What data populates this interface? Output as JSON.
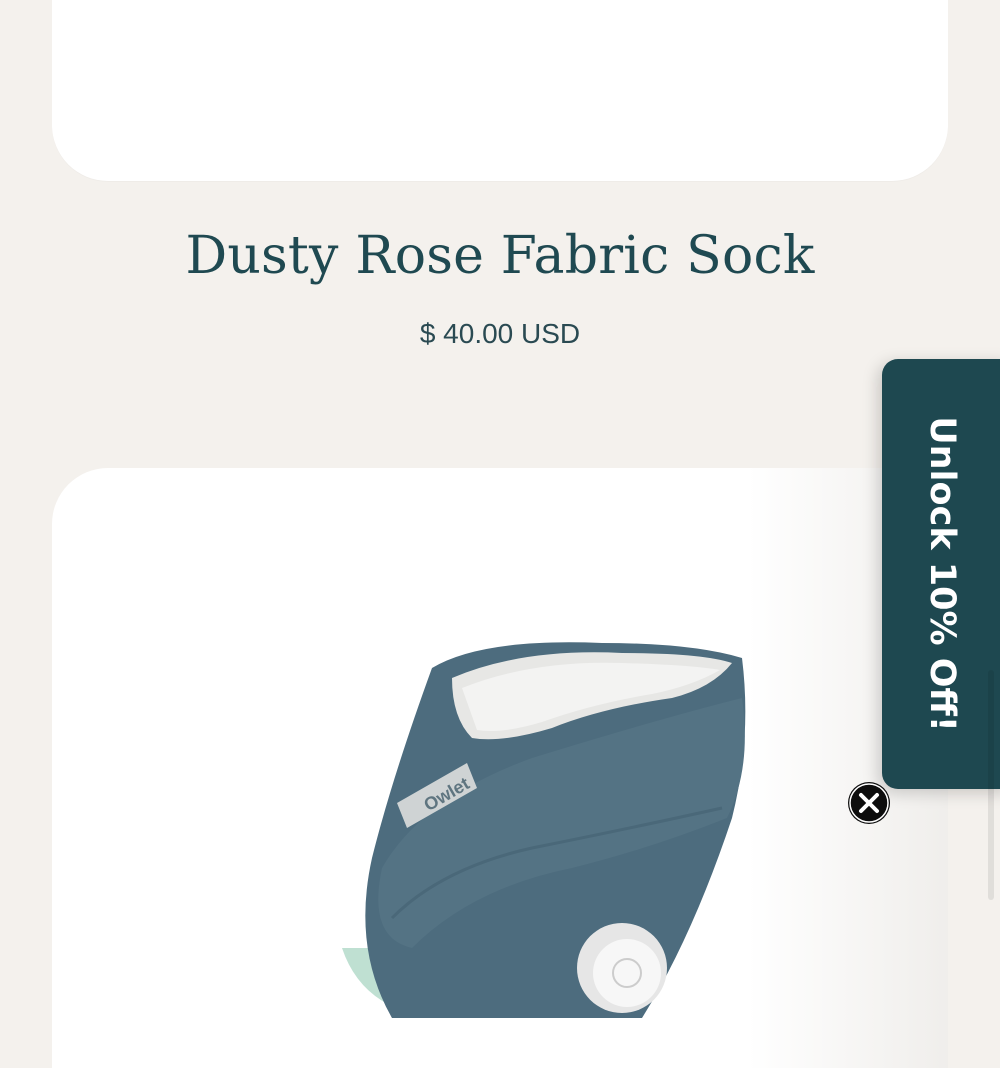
{
  "product": {
    "title": "Dusty Rose Fabric Sock",
    "price": "$ 40.00 USD",
    "image_icon": "baby-sock-icon",
    "image_brand_text": "Owlet"
  },
  "promo": {
    "label": "Unlock 10% Off!",
    "close_icon": "close-icon"
  },
  "colors": {
    "page_background": "#f4f1ed",
    "card_background": "#ffffff",
    "brand_teal": "#1e4850",
    "title_color": "#1f4951",
    "sock_blue": "#4d6c7e"
  }
}
